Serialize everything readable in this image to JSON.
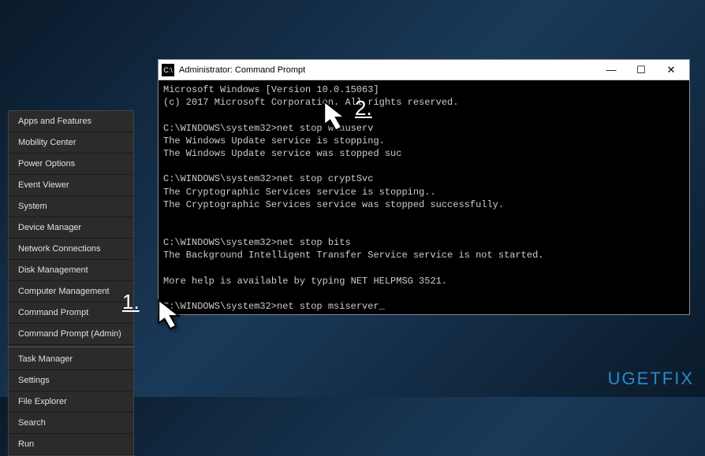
{
  "context_menu": {
    "items": [
      {
        "label": "Apps and Features"
      },
      {
        "label": "Mobility Center"
      },
      {
        "label": "Power Options"
      },
      {
        "label": "Event Viewer"
      },
      {
        "label": "System"
      },
      {
        "label": "Device Manager"
      },
      {
        "label": "Network Connections"
      },
      {
        "label": "Disk Management"
      },
      {
        "label": "Computer Management"
      },
      {
        "label": "Command Prompt"
      },
      {
        "label": "Command Prompt (Admin)"
      },
      {
        "label": "Task Manager"
      },
      {
        "label": "Settings"
      },
      {
        "label": "File Explorer"
      },
      {
        "label": "Search"
      },
      {
        "label": "Run"
      }
    ]
  },
  "cmd_window": {
    "title": "Administrator: Command Prompt",
    "lines": {
      "l1": "Microsoft Windows [Version 10.0.15063]",
      "l2": "(c) 2017 Microsoft Corporation. All rights reserved.",
      "l3": "",
      "l4": "C:\\WINDOWS\\system32>net stop wuauserv",
      "l5": "The Windows Update service is stopping.",
      "l6": "The Windows Update service was stopped suc",
      "l7": "",
      "l8": "C:\\WINDOWS\\system32>net stop cryptSvc",
      "l9": "The Cryptographic Services service is stopping..",
      "l10": "The Cryptographic Services service was stopped successfully.",
      "l11": "",
      "l12": "",
      "l13": "C:\\WINDOWS\\system32>net stop bits",
      "l14": "The Background Intelligent Transfer Service service is not started.",
      "l15": "",
      "l16": "More help is available by typing NET HELPMSG 3521.",
      "l17": "",
      "l18_prompt": "C:\\WINDOWS\\system32>net stop msiserver"
    }
  },
  "annotations": {
    "step1": "1.",
    "step2": "2."
  },
  "watermark": "UGETFIX"
}
